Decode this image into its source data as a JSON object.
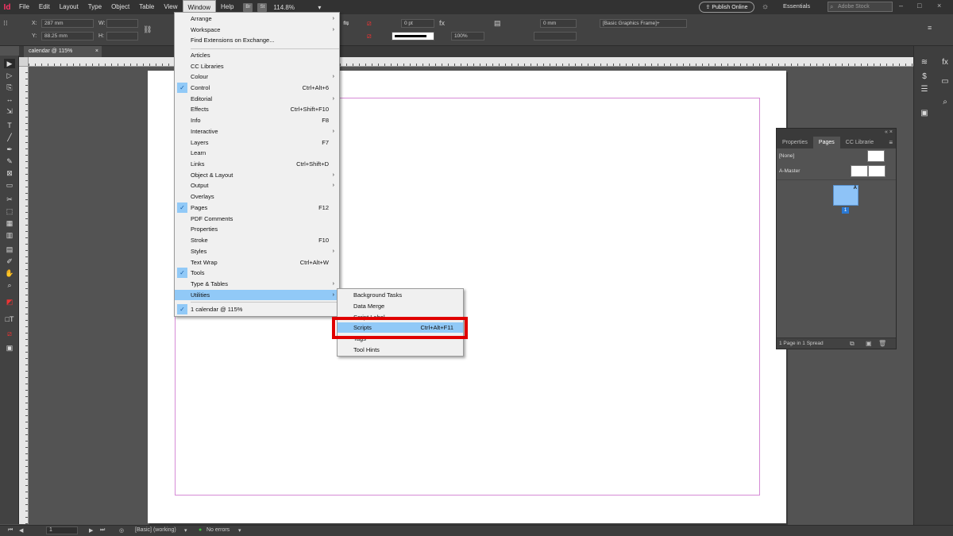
{
  "menubar": {
    "app_icon": "Id",
    "items": [
      "File",
      "Edit",
      "Layout",
      "Type",
      "Object",
      "Table",
      "View",
      "Window",
      "Help"
    ],
    "badges": [
      "Br",
      "St"
    ],
    "zoom": "114.8%",
    "publish_label": "Publish Online",
    "workspace": "Essentials",
    "search_placeholder": "Adobe Stock"
  },
  "controlbar": {
    "x_label": "X:",
    "x_value": "287 mm",
    "y_label": "Y:",
    "y_value": "88.25 mm",
    "w_label": "W:",
    "h_label": "H:",
    "stroke_weight": "0 pt",
    "opacity": "100%",
    "gap": "0 mm",
    "object_style": "[Basic Graphics Frame]+"
  },
  "document": {
    "tab_label": "calendar @ 115%",
    "close": "×"
  },
  "window_menu": {
    "items": [
      {
        "label": "Arrange",
        "submenu": true
      },
      {
        "label": "Workspace",
        "submenu": true
      },
      {
        "label": "Find Extensions on Exchange..."
      },
      {
        "label": "Articles"
      },
      {
        "label": "CC Libraries"
      },
      {
        "label": "Colour",
        "submenu": true
      },
      {
        "label": "Control",
        "shortcut": "Ctrl+Alt+6",
        "checked": true
      },
      {
        "label": "Editorial",
        "submenu": true
      },
      {
        "label": "Effects",
        "shortcut": "Ctrl+Shift+F10"
      },
      {
        "label": "Info",
        "shortcut": "F8"
      },
      {
        "label": "Interactive",
        "submenu": true
      },
      {
        "label": "Layers",
        "shortcut": "F7"
      },
      {
        "label": "Learn"
      },
      {
        "label": "Links",
        "shortcut": "Ctrl+Shift+D"
      },
      {
        "label": "Object & Layout",
        "submenu": true
      },
      {
        "label": "Output",
        "submenu": true
      },
      {
        "label": "Overlays"
      },
      {
        "label": "Pages",
        "shortcut": "F12",
        "checked": true
      },
      {
        "label": "PDF Comments"
      },
      {
        "label": "Properties"
      },
      {
        "label": "Stroke",
        "shortcut": "F10"
      },
      {
        "label": "Styles",
        "submenu": true
      },
      {
        "label": "Text Wrap",
        "shortcut": "Ctrl+Alt+W"
      },
      {
        "label": "Tools",
        "checked": true
      },
      {
        "label": "Type & Tables",
        "submenu": true
      },
      {
        "label": "Utilities",
        "submenu": true,
        "highlighted": true
      },
      {
        "label": "1 calendar @ 115%",
        "checked": true
      }
    ]
  },
  "utilities_submenu": {
    "items": [
      {
        "label": "Background Tasks"
      },
      {
        "label": "Data Merge"
      },
      {
        "label": "Script Label"
      },
      {
        "label": "Scripts",
        "shortcut": "Ctrl+Alt+F11",
        "highlighted": true
      },
      {
        "label": "Tags"
      },
      {
        "label": "Tool Hints"
      }
    ]
  },
  "pages_panel": {
    "collapse": "«",
    "close": "×",
    "tabs": [
      "Properties",
      "Pages",
      "CC Librarie"
    ],
    "active_tab": "Pages",
    "none_label": "[None]",
    "master_label": "A-Master",
    "page_master": "A",
    "page_number": "1",
    "footer": "1 Page in 1 Spread"
  },
  "statusbar": {
    "page": "1",
    "profile": "[Basic] (working)",
    "errors": "No errors"
  },
  "colors": {
    "highlight": "#91c9f7",
    "red_box": "#e00000",
    "margin_guide": "#d68bd6",
    "app_logo": "#ff3366"
  }
}
